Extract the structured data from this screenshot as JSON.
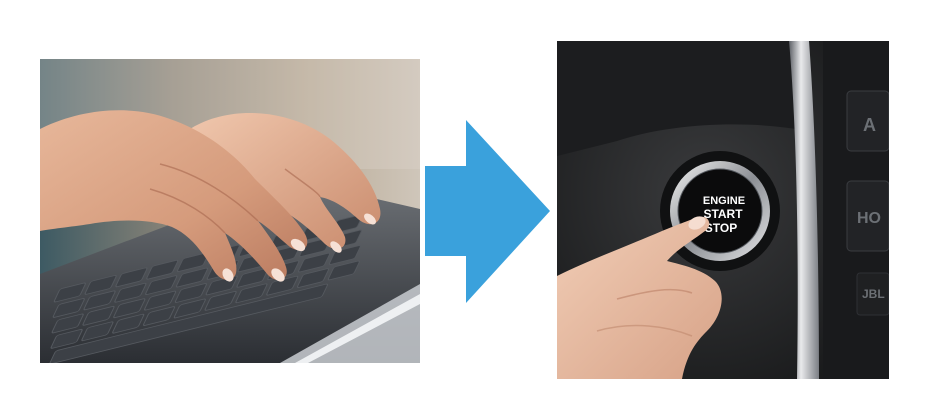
{
  "arrow": {
    "color": "#3aa1dc",
    "icon": "right-arrow-icon"
  },
  "left_photo": {
    "subject": "hands-typing-on-laptop-keyboard"
  },
  "right_photo": {
    "subject": "finger-pressing-engine-start-stop-button",
    "button_lines": [
      "ENGINE",
      "START",
      "STOP"
    ],
    "side_button_1": "A",
    "side_button_2": "HO",
    "badge": "JBL"
  }
}
